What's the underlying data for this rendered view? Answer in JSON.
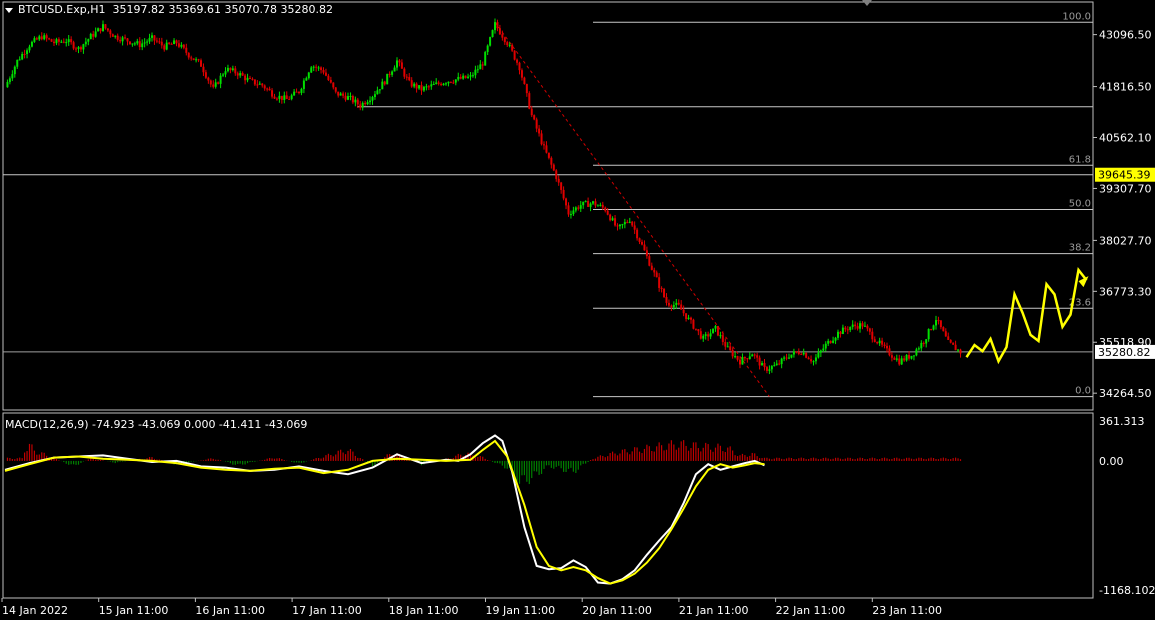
{
  "header": {
    "symbol": "BTCUSD.Exp,H1",
    "ohlc": "35197.82 35369.61 35070.78 35280.82",
    "menu_icon": "triangle-down-icon"
  },
  "macd": {
    "label": "MACD(12,26,9) -74.923 -43.069 0.000 -41.411 -43.069"
  },
  "colors": {
    "background": "#000000",
    "bull": "#00e000",
    "bear": "#e00000",
    "macd_line": "#ffffff",
    "signal_line": "#ffff00",
    "fib": "#c8c8c8",
    "arrow": "#ffff00"
  },
  "chart_data": [
    {
      "type": "candlestick",
      "title": "BTCUSD.Exp,H1",
      "ylim": [
        33850,
        43900
      ],
      "y_ticks": [
        43096.5,
        41816.5,
        40562.1,
        39307.7,
        38027.7,
        36773.3,
        35518.9,
        34264.5
      ],
      "y_tick_labels": [
        "43096.50",
        "41816.50",
        "40562.10",
        "39307.70",
        "38027.70",
        "36773.30",
        "35518.90",
        "34264.50"
      ],
      "x_tick_labels": [
        "14 Jan 2022",
        "15 Jan 11:00",
        "16 Jan 11:00",
        "17 Jan 11:00",
        "18 Jan 11:00",
        "19 Jan 11:00",
        "20 Jan 11:00",
        "21 Jan 11:00",
        "22 Jan 11:00",
        "23 Jan 11:00"
      ],
      "price_markers": [
        {
          "label": "39645.39",
          "value": 39645.39,
          "style": "highlight"
        },
        {
          "label": "35280.82",
          "value": 35280.82,
          "style": "current"
        }
      ],
      "horizontal_lines": [
        39645.39,
        35280.82,
        41320
      ],
      "fibonacci": {
        "high": 43400,
        "low": 34180,
        "levels": [
          {
            "label": "100.0",
            "ratio": 1.0
          },
          {
            "label": "61.8",
            "ratio": 0.618
          },
          {
            "label": "50.0",
            "ratio": 0.5
          },
          {
            "label": "38.2",
            "ratio": 0.382
          },
          {
            "label": "23.6",
            "ratio": 0.236
          },
          {
            "label": "0.0",
            "ratio": 0.0
          }
        ]
      },
      "close_path": [
        [
          0,
          41800
        ],
        [
          5,
          42450
        ],
        [
          10,
          42850
        ],
        [
          15,
          43050
        ],
        [
          20,
          42900
        ],
        [
          25,
          42950
        ],
        [
          30,
          42750
        ],
        [
          35,
          43050
        ],
        [
          40,
          43300
        ],
        [
          45,
          43050
        ],
        [
          50,
          42950
        ],
        [
          55,
          42850
        ],
        [
          60,
          43000
        ],
        [
          65,
          42800
        ],
        [
          70,
          42900
        ],
        [
          75,
          42600
        ],
        [
          80,
          42350
        ],
        [
          85,
          41750
        ],
        [
          90,
          42250
        ],
        [
          95,
          42150
        ],
        [
          100,
          41950
        ],
        [
          105,
          41850
        ],
        [
          110,
          41600
        ],
        [
          115,
          41500
        ],
        [
          120,
          41700
        ],
        [
          125,
          42350
        ],
        [
          130,
          42200
        ],
        [
          135,
          41650
        ],
        [
          140,
          41550
        ],
        [
          145,
          41350
        ],
        [
          150,
          41600
        ],
        [
          155,
          41950
        ],
        [
          160,
          42450
        ],
        [
          165,
          41900
        ],
        [
          170,
          41750
        ],
        [
          175,
          41850
        ],
        [
          180,
          41950
        ],
        [
          185,
          42000
        ],
        [
          190,
          42050
        ],
        [
          195,
          42400
        ],
        [
          200,
          43350
        ],
        [
          205,
          42900
        ],
        [
          210,
          42300
        ],
        [
          215,
          41100
        ],
        [
          220,
          40300
        ],
        [
          225,
          39600
        ],
        [
          230,
          38700
        ],
        [
          235,
          38900
        ],
        [
          240,
          38950
        ],
        [
          245,
          38800
        ],
        [
          250,
          38300
        ],
        [
          255,
          38550
        ],
        [
          260,
          37900
        ],
        [
          265,
          37200
        ],
        [
          270,
          36500
        ],
        [
          275,
          36400
        ],
        [
          280,
          36000
        ],
        [
          285,
          35600
        ],
        [
          290,
          35850
        ],
        [
          295,
          35350
        ],
        [
          300,
          35050
        ],
        [
          305,
          35250
        ],
        [
          310,
          34850
        ],
        [
          315,
          34950
        ],
        [
          320,
          35200
        ],
        [
          325,
          35300
        ],
        [
          330,
          35050
        ],
        [
          335,
          35450
        ],
        [
          340,
          35750
        ],
        [
          345,
          35900
        ],
        [
          350,
          35950
        ],
        [
          355,
          35600
        ],
        [
          360,
          35300
        ],
        [
          365,
          35050
        ],
        [
          370,
          35200
        ],
        [
          375,
          35550
        ],
        [
          380,
          36100
        ],
        [
          385,
          35500
        ],
        [
          390,
          35280
        ]
      ],
      "projection_path": [
        [
          35150,
          35450
        ],
        [
          35300,
          35600
        ],
        [
          35050,
          35400
        ],
        [
          36700,
          36250
        ],
        [
          35700,
          35550
        ],
        [
          36950,
          36700
        ],
        [
          35900,
          36200
        ],
        [
          37300,
          37050
        ]
      ]
    },
    {
      "type": "line",
      "title": "MACD(12,26,9)",
      "ylim": [
        -1168.102,
        361.313
      ],
      "y_tick_labels": [
        "361.313",
        "0.00",
        "-1168.102"
      ],
      "series": [
        {
          "role": "macd",
          "color": "#ffffff",
          "values": [
            [
              0,
              -80
            ],
            [
              10,
              -20
            ],
            [
              20,
              30
            ],
            [
              30,
              40
            ],
            [
              40,
              50
            ],
            [
              50,
              20
            ],
            [
              60,
              -10
            ],
            [
              70,
              0
            ],
            [
              80,
              -50
            ],
            [
              90,
              -60
            ],
            [
              100,
              -90
            ],
            [
              110,
              -80
            ],
            [
              120,
              -50
            ],
            [
              130,
              -90
            ],
            [
              140,
              -120
            ],
            [
              150,
              -60
            ],
            [
              160,
              60
            ],
            [
              170,
              -20
            ],
            [
              180,
              10
            ],
            [
              185,
              0
            ],
            [
              190,
              60
            ],
            [
              195,
              160
            ],
            [
              200,
              230
            ],
            [
              203,
              180
            ],
            [
              207,
              -100
            ],
            [
              212,
              -600
            ],
            [
              217,
              -950
            ],
            [
              222,
              -980
            ],
            [
              227,
              -970
            ],
            [
              232,
              -900
            ],
            [
              237,
              -960
            ],
            [
              242,
              -1100
            ],
            [
              247,
              -1110
            ],
            [
              252,
              -1070
            ],
            [
              257,
              -990
            ],
            [
              262,
              -850
            ],
            [
              267,
              -720
            ],
            [
              272,
              -600
            ],
            [
              277,
              -380
            ],
            [
              282,
              -120
            ],
            [
              287,
              -30
            ],
            [
              292,
              -80
            ],
            [
              297,
              -50
            ],
            [
              302,
              -20
            ],
            [
              306,
              0
            ],
            [
              310,
              -40
            ]
          ]
        },
        {
          "role": "signal",
          "color": "#ffff00",
          "values": [
            [
              0,
              -90
            ],
            [
              10,
              -30
            ],
            [
              20,
              30
            ],
            [
              30,
              40
            ],
            [
              40,
              20
            ],
            [
              50,
              10
            ],
            [
              60,
              0
            ],
            [
              70,
              -20
            ],
            [
              80,
              -60
            ],
            [
              90,
              -80
            ],
            [
              100,
              -90
            ],
            [
              110,
              -70
            ],
            [
              120,
              -60
            ],
            [
              130,
              -110
            ],
            [
              140,
              -80
            ],
            [
              150,
              0
            ],
            [
              160,
              20
            ],
            [
              170,
              10
            ],
            [
              180,
              0
            ],
            [
              190,
              10
            ],
            [
              195,
              100
            ],
            [
              200,
              180
            ],
            [
              205,
              40
            ],
            [
              212,
              -400
            ],
            [
              217,
              -780
            ],
            [
              222,
              -950
            ],
            [
              227,
              -990
            ],
            [
              232,
              -960
            ],
            [
              237,
              -990
            ],
            [
              242,
              -1060
            ],
            [
              247,
              -1110
            ],
            [
              252,
              -1080
            ],
            [
              257,
              -1020
            ],
            [
              262,
              -920
            ],
            [
              267,
              -790
            ],
            [
              272,
              -620
            ],
            [
              277,
              -430
            ],
            [
              282,
              -230
            ],
            [
              287,
              -80
            ],
            [
              292,
              -30
            ],
            [
              297,
              -60
            ],
            [
              302,
              -40
            ],
            [
              306,
              -20
            ],
            [
              310,
              -30
            ]
          ]
        }
      ],
      "histogram_peaks": [
        [
          8,
          140
        ],
        [
          10,
          180
        ],
        [
          12,
          120
        ],
        [
          28,
          -60
        ],
        [
          35,
          30
        ],
        [
          45,
          -20
        ],
        [
          60,
          40
        ],
        [
          70,
          -40
        ],
        [
          85,
          30
        ],
        [
          95,
          -50
        ],
        [
          110,
          40
        ],
        [
          120,
          -30
        ],
        [
          140,
          130
        ],
        [
          150,
          -60
        ],
        [
          158,
          100
        ],
        [
          170,
          -40
        ],
        [
          180,
          20
        ],
        [
          188,
          90
        ],
        [
          195,
          40
        ],
        [
          205,
          -80
        ],
        [
          210,
          -250
        ],
        [
          215,
          -200
        ],
        [
          222,
          -60
        ],
        [
          232,
          -130
        ],
        [
          240,
          30
        ],
        [
          250,
          100
        ],
        [
          260,
          140
        ],
        [
          270,
          180
        ],
        [
          275,
          200
        ],
        [
          280,
          180
        ],
        [
          285,
          170
        ],
        [
          290,
          160
        ],
        [
          295,
          150
        ],
        [
          300,
          60
        ],
        [
          305,
          80
        ],
        [
          310,
          30
        ]
      ]
    }
  ]
}
